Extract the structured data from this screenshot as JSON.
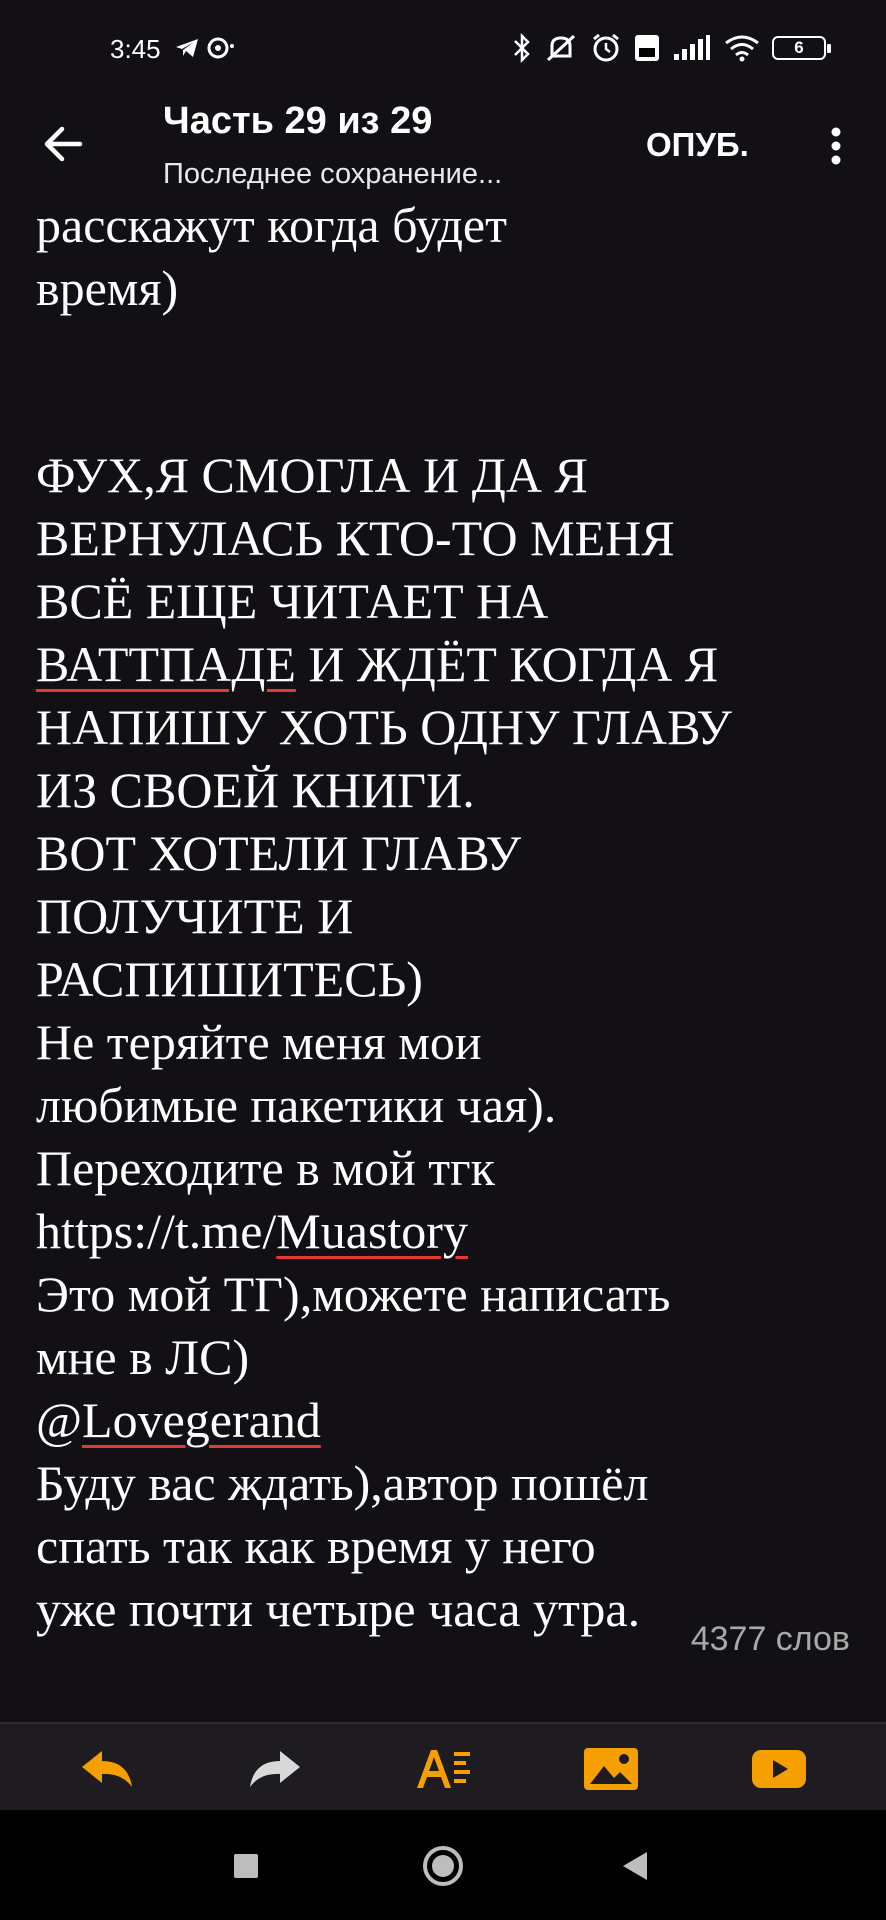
{
  "status_bar": {
    "time": "3:45",
    "battery": "6"
  },
  "header": {
    "title": "Часть 29 из 29",
    "subtitle": "Последнее сохранение...",
    "publish_label": "ОПУБ."
  },
  "content": {
    "p1_a": "расскажут когда будет",
    "p1_b": "время)",
    "p2_a": "ФУХ,Я СМОГЛА И ДА Я",
    "p2_b": "ВЕРНУЛАСЬ КТО-ТО МЕНЯ",
    "p2_c": "ВСЁ ЕЩЕ ЧИТАЕТ НА",
    "p2_d_spell": "ВАТТПАДЕ",
    "p2_d_rest": " И ЖДЁТ КОГДА Я",
    "p2_e": "НАПИШУ ХОТЬ ОДНУ ГЛАВУ",
    "p2_f": "ИЗ СВОЕЙ КНИГИ.",
    "p2_g": "ВОТ ХОТЕЛИ ГЛАВУ",
    "p2_h": "ПОЛУЧИТЕ И",
    "p2_i": "РАСПИШИТЕСЬ)",
    "p3_a": "Не теряйте меня мои",
    "p3_b": "любимые пакетики чая).",
    "p3_c": "Переходите в мой тгк",
    "p3_d_prefix": "https://t.me/",
    "p3_d_spell": "Muastory",
    "p3_e": "Это мой ТГ),можете написать",
    "p3_f": "мне в ЛС)",
    "p3_g_prefix": "@",
    "p3_g_spell": "Lovegerand",
    "p3_h": "Буду вас ждать),автор пошёл",
    "p3_i": "спать так как время у него",
    "p3_j": "уже почти четыре часа утра."
  },
  "word_count": "4377 слов",
  "toolbar": {
    "icons": [
      "undo-icon",
      "redo-icon",
      "text-format-icon",
      "insert-image-icon",
      "insert-video-icon"
    ],
    "accent": "#f5a000"
  },
  "nav": {
    "icons": [
      "recents-icon",
      "home-icon",
      "back-icon"
    ]
  }
}
